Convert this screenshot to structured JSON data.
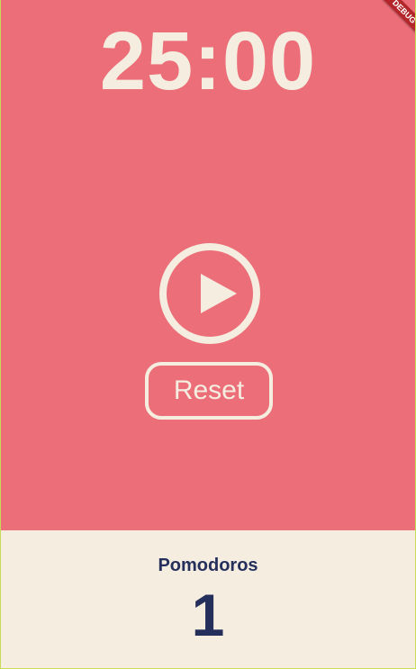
{
  "timer": {
    "display": "25:00"
  },
  "controls": {
    "play_icon": "play-icon",
    "reset_label": "Reset"
  },
  "pomodoros": {
    "label": "Pomodoros",
    "count": "1"
  },
  "debug_banner": {
    "label": "DEBUG"
  },
  "colors": {
    "accent": "#eb6e78",
    "cream": "#f5ede0",
    "navy": "#252f5b"
  }
}
